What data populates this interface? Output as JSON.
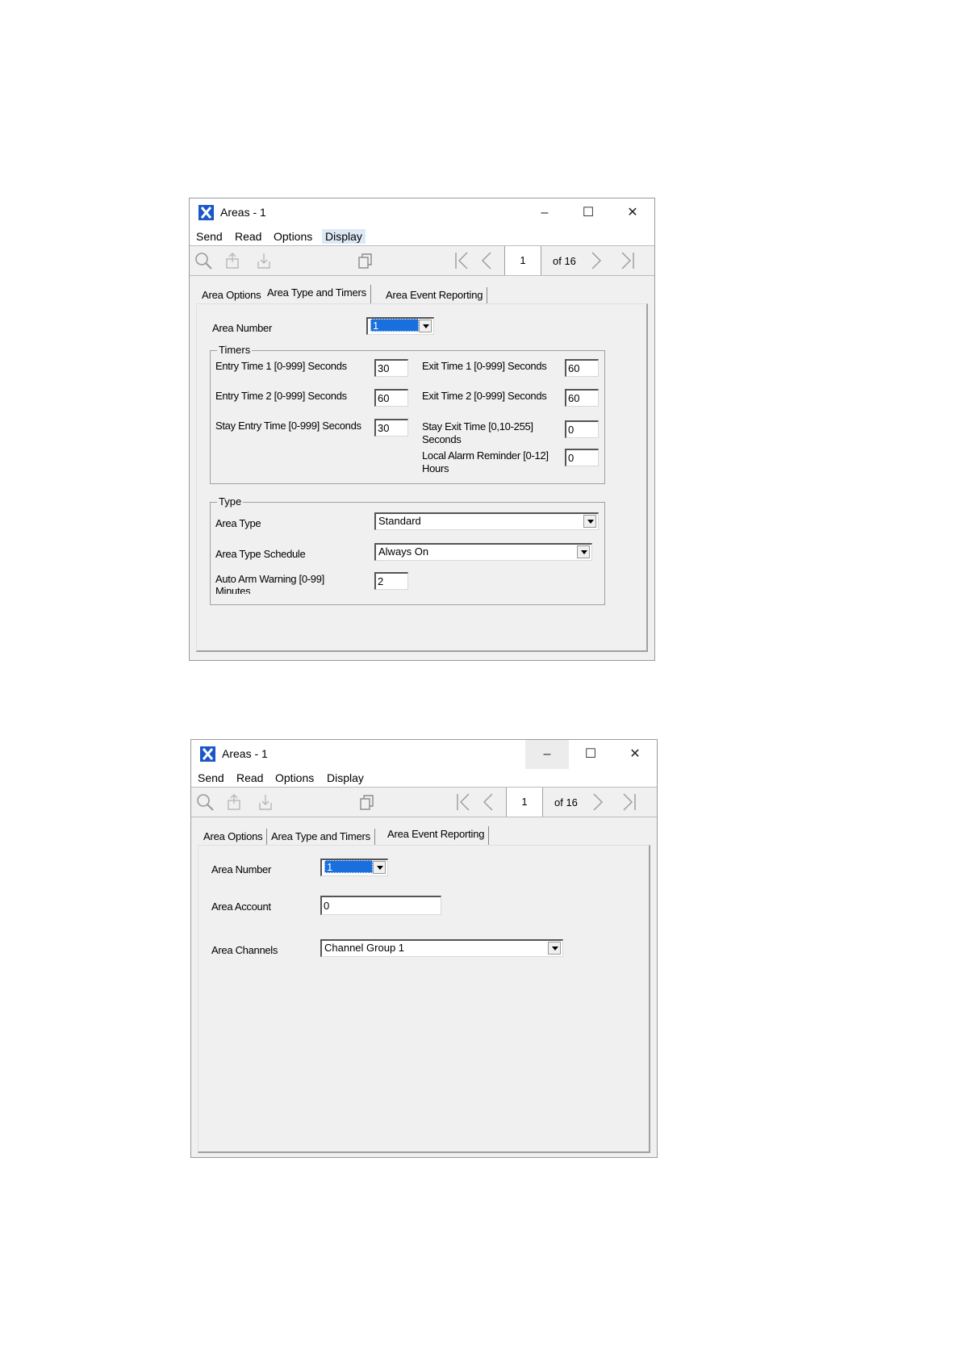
{
  "window1": {
    "title": "Areas - 1",
    "controls": {
      "minimize": "–",
      "maximize": "☐",
      "close": "✕"
    },
    "menu": [
      "Send",
      "Read",
      "Options",
      "Display"
    ],
    "pager": {
      "page": "1",
      "of": "of 16"
    },
    "tabs": [
      "Area Options",
      "Area Type and Timers",
      "Area Event Reporting"
    ],
    "selected_tab": "Area Type and Timers",
    "area_number_label": "Area Number",
    "area_number_value": "1",
    "timers": {
      "legend": "Timers",
      "entry1_label": "Entry Time 1 [0-999] Seconds",
      "entry1_value": "30",
      "entry2_label": "Entry Time 2 [0-999] Seconds",
      "entry2_value": "60",
      "stay_entry_label": "Stay Entry Time [0-999] Seconds",
      "stay_entry_value": "30",
      "exit1_label": "Exit Time 1 [0-999] Seconds",
      "exit1_value": "60",
      "exit2_label": "Exit Time 2 [0-999] Seconds",
      "exit2_value": "60",
      "stay_exit_label_1": "Stay Exit Time [0,10-255]",
      "stay_exit_label_2": "Seconds",
      "stay_exit_value": "0",
      "reminder_label_1": "Local Alarm Reminder [0-12]",
      "reminder_label_2": "Hours",
      "reminder_value": "0"
    },
    "type": {
      "legend": "Type",
      "area_type_label": "Area Type",
      "area_type_value": "Standard",
      "schedule_label": "Area Type Schedule",
      "schedule_value": "Always On",
      "auto_arm_label_1": "Auto Arm Warning [0-99]",
      "auto_arm_label_2": "Minutes",
      "auto_arm_value": "2"
    }
  },
  "window2": {
    "title": "Areas - 1",
    "controls": {
      "minimize": "–",
      "maximize": "☐",
      "close": "✕"
    },
    "menu": [
      "Send",
      "Read",
      "Options",
      "Display"
    ],
    "pager": {
      "page": "1",
      "of": "of 16"
    },
    "tabs": [
      "Area Options",
      "Area Type and Timers",
      "Area Event Reporting"
    ],
    "selected_tab": "Area Event Reporting",
    "area_number_label": "Area Number",
    "area_number_value": "1",
    "area_account_label": "Area Account",
    "area_account_value": "0",
    "area_channels_label": "Area Channels",
    "area_channels_value": "Channel Group 1"
  },
  "colors": {
    "accent": "#1a57c8",
    "selection": "#1a6fde",
    "panel": "#f0f0f0"
  },
  "icons": [
    "app-icon",
    "search-icon",
    "upload-icon",
    "download-icon",
    "copy-icon",
    "first-page-icon",
    "prev-page-icon",
    "next-page-icon",
    "last-page-icon"
  ]
}
